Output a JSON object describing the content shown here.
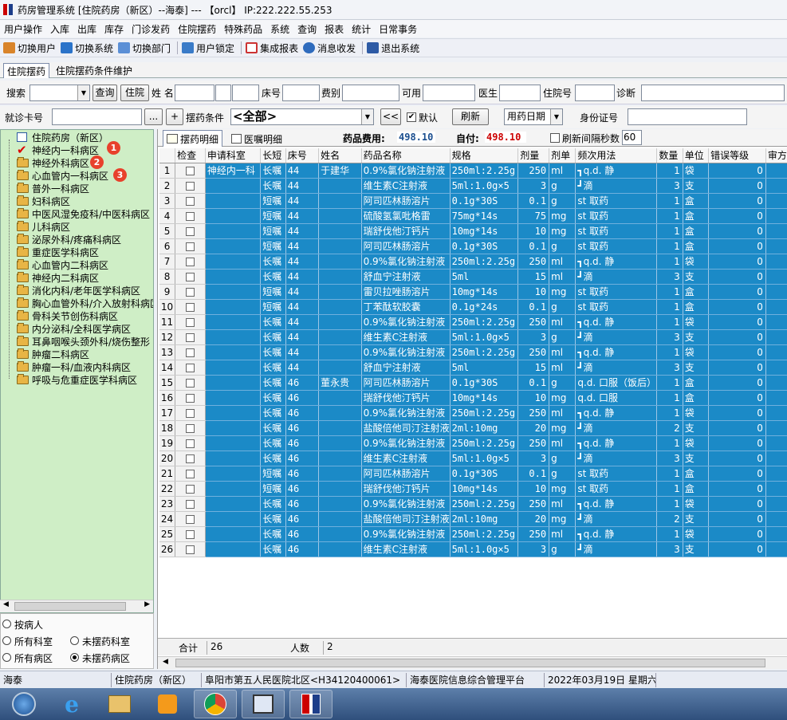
{
  "window": {
    "title": "药房管理系统 [住院药房（新区）--海泰] --- 【orcl】 IP:222.222.55.253"
  },
  "menu": [
    "用户操作",
    "入库",
    "出库",
    "库存",
    "门诊发药",
    "住院摆药",
    "特殊药品",
    "系统",
    "查询",
    "报表",
    "统计",
    "日常事务"
  ],
  "toolbar": [
    {
      "label": "切换用户",
      "icon": "users-icon",
      "color": "#d9842a"
    },
    {
      "label": "切换系统",
      "icon": "switch-system-icon",
      "color": "#2b73c9"
    },
    {
      "label": "切换部门",
      "icon": "department-icon",
      "color": "#5b8fd6"
    },
    {
      "label": "用户锁定",
      "icon": "user-lock-icon",
      "color": "#3a7bc8"
    },
    {
      "label": "集成报表",
      "icon": "report-icon",
      "color": "#c33"
    },
    {
      "label": "消息收发",
      "icon": "info-icon",
      "color": "#2e6bbd"
    },
    {
      "label": "退出系统",
      "icon": "exit-icon",
      "color": "#2d5aa5"
    }
  ],
  "tabs_main": [
    {
      "label": "住院摆药",
      "active": true
    },
    {
      "label": "住院摆药条件维护",
      "active": false
    }
  ],
  "search": {
    "label": "搜索",
    "query_button": "查询",
    "inpatient_button": "住院",
    "name_label": "姓 名",
    "bed_label": "床号",
    "fee_label": "费别",
    "available_label": "可用",
    "doctor_label": "医生",
    "inpatient_no_label": "住院号",
    "diagnosis_label": "诊断"
  },
  "conditions": {
    "card_label": "就诊卡号",
    "ellipsis_button": "...",
    "plus_button": "+",
    "cond_label": "摆药条件",
    "cond_value": "<全部>",
    "back_button": "<<",
    "default_label": "默认",
    "default_checked": true,
    "refresh_button": "刷新",
    "date_type": "用药日期",
    "idcard_label": "身份证号"
  },
  "tree": {
    "root": "住院药房（新区）",
    "items": [
      "神经内一科病区",
      "神经外科病区",
      "心血管内一科病区",
      "普外一科病区",
      "妇科病区",
      "中医风湿免疫科/中医科病区",
      "儿科病区",
      "泌尿外科/疼痛科病区",
      "重症医学科病区",
      "心血管内二科病区",
      "神经内二科病区",
      "消化内科/老年医学科病区",
      "胸心血管外科/介入放射科病区",
      "骨科关节创伤科病区",
      "内分泌科/全科医学病区",
      "耳鼻咽喉头颈外科/烧伤整形",
      "肿瘤二科病区",
      "肿瘤一科/血液内科病区",
      "呼吸与危重症医学科病区"
    ],
    "badges": [
      "1",
      "2",
      "3"
    ]
  },
  "radio": {
    "by_patient": "按病人",
    "all_dept": "所有科室",
    "not_dept": "未摆药科室",
    "all_ward": "所有病区",
    "not_ward": "未摆药病区"
  },
  "detail_tabs": {
    "tab1": "摆药明细",
    "tab2": "医嘱明细",
    "fee_label": "药品费用:",
    "fee_value": "498.10",
    "self_label": "自付:",
    "self_value": "498.10",
    "refresh_interval_label": "刷新间隔秒数",
    "refresh_interval_value": "60"
  },
  "columns": [
    "检查",
    "申请科室",
    "长短",
    "床号",
    "姓名",
    "药品名称",
    "规格",
    "剂量",
    "剂单",
    "频次用法",
    "数量",
    "单位",
    "错误等级",
    "审方"
  ],
  "rows": [
    [
      "1",
      "神经内一科",
      "长嘱",
      "44",
      "于建华",
      "0.9%氯化钠注射液",
      "250ml:2.25g",
      "250",
      "ml",
      "┓q.d. 静",
      "1",
      "袋",
      "0"
    ],
    [
      "2",
      "",
      "长嘱",
      "44",
      "",
      "维生素C注射液",
      "5ml:1.0g×5",
      "3",
      "g",
      "┛滴",
      "3",
      "支",
      "0"
    ],
    [
      "3",
      "",
      "短嘱",
      "44",
      "",
      "阿司匹林肠溶片",
      "0.1g*30S",
      "0.1",
      "g",
      "st 取药",
      "1",
      "盒",
      "0"
    ],
    [
      "4",
      "",
      "短嘱",
      "44",
      "",
      "硫酸氢氯吡格雷",
      "75mg*14s",
      "75",
      "mg",
      "st 取药",
      "1",
      "盒",
      "0"
    ],
    [
      "5",
      "",
      "短嘱",
      "44",
      "",
      "瑞舒伐他汀钙片",
      "10mg*14s",
      "10",
      "mg",
      "st 取药",
      "1",
      "盒",
      "0"
    ],
    [
      "6",
      "",
      "短嘱",
      "44",
      "",
      "阿司匹林肠溶片",
      "0.1g*30S",
      "0.1",
      "g",
      "st 取药",
      "1",
      "盒",
      "0"
    ],
    [
      "7",
      "",
      "长嘱",
      "44",
      "",
      "0.9%氯化钠注射液",
      "250ml:2.25g",
      "250",
      "ml",
      "┓q.d. 静",
      "1",
      "袋",
      "0"
    ],
    [
      "8",
      "",
      "长嘱",
      "44",
      "",
      "舒血宁注射液",
      "5ml",
      "15",
      "ml",
      "┛滴",
      "3",
      "支",
      "0"
    ],
    [
      "9",
      "",
      "短嘱",
      "44",
      "",
      "雷贝拉唑肠溶片",
      "10mg*14s",
      "10",
      "mg",
      "st 取药",
      "1",
      "盒",
      "0"
    ],
    [
      "10",
      "",
      "短嘱",
      "44",
      "",
      "丁苯酞软胶囊",
      "0.1g*24s",
      "0.1",
      "g",
      "st 取药",
      "1",
      "盒",
      "0"
    ],
    [
      "11",
      "",
      "长嘱",
      "44",
      "",
      "0.9%氯化钠注射液",
      "250ml:2.25g",
      "250",
      "ml",
      "┓q.d. 静",
      "1",
      "袋",
      "0"
    ],
    [
      "12",
      "",
      "长嘱",
      "44",
      "",
      "维生素C注射液",
      "5ml:1.0g×5",
      "3",
      "g",
      "┛滴",
      "3",
      "支",
      "0"
    ],
    [
      "13",
      "",
      "长嘱",
      "44",
      "",
      "0.9%氯化钠注射液",
      "250ml:2.25g",
      "250",
      "ml",
      "┓q.d. 静",
      "1",
      "袋",
      "0"
    ],
    [
      "14",
      "",
      "长嘱",
      "44",
      "",
      "舒血宁注射液",
      "5ml",
      "15",
      "ml",
      "┛滴",
      "3",
      "支",
      "0"
    ],
    [
      "15",
      "",
      "长嘱",
      "46",
      "董永贵",
      "阿司匹林肠溶片",
      "0.1g*30S",
      "0.1",
      "g",
      "q.d. 口服（饭后）",
      "1",
      "盒",
      "0"
    ],
    [
      "16",
      "",
      "长嘱",
      "46",
      "",
      "瑞舒伐他汀钙片",
      "10mg*14s",
      "10",
      "mg",
      "q.d. 口服",
      "1",
      "盒",
      "0"
    ],
    [
      "17",
      "",
      "长嘱",
      "46",
      "",
      "0.9%氯化钠注射液",
      "250ml:2.25g",
      "250",
      "ml",
      "┓q.d. 静",
      "1",
      "袋",
      "0"
    ],
    [
      "18",
      "",
      "长嘱",
      "46",
      "",
      "盐酸倍他司汀注射液",
      "2ml:10mg",
      "20",
      "mg",
      "┛滴",
      "2",
      "支",
      "0"
    ],
    [
      "19",
      "",
      "长嘱",
      "46",
      "",
      "0.9%氯化钠注射液",
      "250ml:2.25g",
      "250",
      "ml",
      "┓q.d. 静",
      "1",
      "袋",
      "0"
    ],
    [
      "20",
      "",
      "长嘱",
      "46",
      "",
      "维生素C注射液",
      "5ml:1.0g×5",
      "3",
      "g",
      "┛滴",
      "3",
      "支",
      "0"
    ],
    [
      "21",
      "",
      "短嘱",
      "46",
      "",
      "阿司匹林肠溶片",
      "0.1g*30S",
      "0.1",
      "g",
      "st 取药",
      "1",
      "盒",
      "0"
    ],
    [
      "22",
      "",
      "短嘱",
      "46",
      "",
      "瑞舒伐他汀钙片",
      "10mg*14s",
      "10",
      "mg",
      "st 取药",
      "1",
      "盒",
      "0"
    ],
    [
      "23",
      "",
      "长嘱",
      "46",
      "",
      "0.9%氯化钠注射液",
      "250ml:2.25g",
      "250",
      "ml",
      "┓q.d. 静",
      "1",
      "袋",
      "0"
    ],
    [
      "24",
      "",
      "长嘱",
      "46",
      "",
      "盐酸倍他司汀注射液",
      "2ml:10mg",
      "20",
      "mg",
      "┛滴",
      "2",
      "支",
      "0"
    ],
    [
      "25",
      "",
      "长嘱",
      "46",
      "",
      "0.9%氯化钠注射液",
      "250ml:2.25g",
      "250",
      "ml",
      "┓q.d. 静",
      "1",
      "袋",
      "0"
    ],
    [
      "26",
      "",
      "长嘱",
      "46",
      "",
      "维生素C注射液",
      "5ml:1.0g×5",
      "3",
      "g",
      "┛滴",
      "3",
      "支",
      "0"
    ]
  ],
  "summary": {
    "total_label": "合计",
    "total_value": "26",
    "people_label": "人数",
    "people_value": "2"
  },
  "status": [
    "海泰",
    "住院药房（新区）",
    "阜阳市第五人民医院北区<H34120400061>",
    "海泰医院信息综合管理平台",
    "2022年03月19日 星期六"
  ],
  "taskbar": [
    "start-orb-icon",
    "internet-explorer-icon",
    "file-explorer-icon",
    "media-player-icon",
    "chrome-icon",
    "sql-tool-icon",
    "pharmacy-app-icon"
  ]
}
